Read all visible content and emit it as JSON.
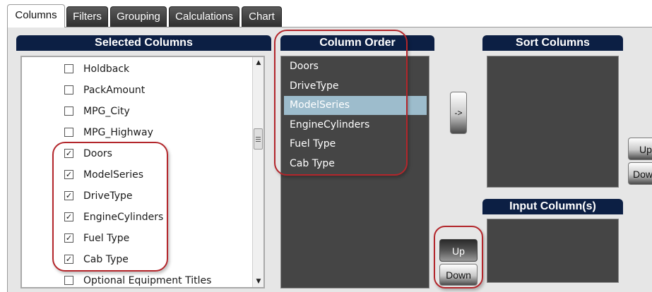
{
  "tabs": [
    {
      "label": "Columns",
      "active": true
    },
    {
      "label": "Filters",
      "active": false
    },
    {
      "label": "Grouping",
      "active": false
    },
    {
      "label": "Calculations",
      "active": false
    },
    {
      "label": "Chart",
      "active": false
    }
  ],
  "selected_columns": {
    "title": "Selected Columns",
    "items": [
      {
        "label": "Holdback",
        "checked": false
      },
      {
        "label": "PackAmount",
        "checked": false
      },
      {
        "label": "MPG_City",
        "checked": false
      },
      {
        "label": "MPG_Highway",
        "checked": false
      },
      {
        "label": "Doors",
        "checked": true
      },
      {
        "label": "ModelSeries",
        "checked": true
      },
      {
        "label": "DriveType",
        "checked": true
      },
      {
        "label": "EngineCylinders",
        "checked": true
      },
      {
        "label": "Fuel Type",
        "checked": true
      },
      {
        "label": "Cab Type",
        "checked": true
      },
      {
        "label": "Optional Equipment Titles",
        "checked": false
      }
    ],
    "check_mark": "✓",
    "scroll_up_glyph": "▲",
    "scroll_down_glyph": "▼"
  },
  "column_order": {
    "title": "Column Order",
    "items": [
      "Doors",
      "DriveType",
      "ModelSeries",
      "EngineCylinders",
      "Fuel Type",
      "Cab Type"
    ],
    "selected_item": "ModelSeries",
    "up_label": "Up",
    "down_label": "Down"
  },
  "move_button_label": "->",
  "sort_columns": {
    "title": "Sort Columns",
    "up_label": "Up",
    "down_label": "Down"
  },
  "input_columns": {
    "title": "Input Column(s)"
  },
  "colors": {
    "header_bg": "#0c1f44",
    "list_bg": "#454545",
    "selected_row": "#9dbccc",
    "highlight_ring": "#b3262b"
  }
}
